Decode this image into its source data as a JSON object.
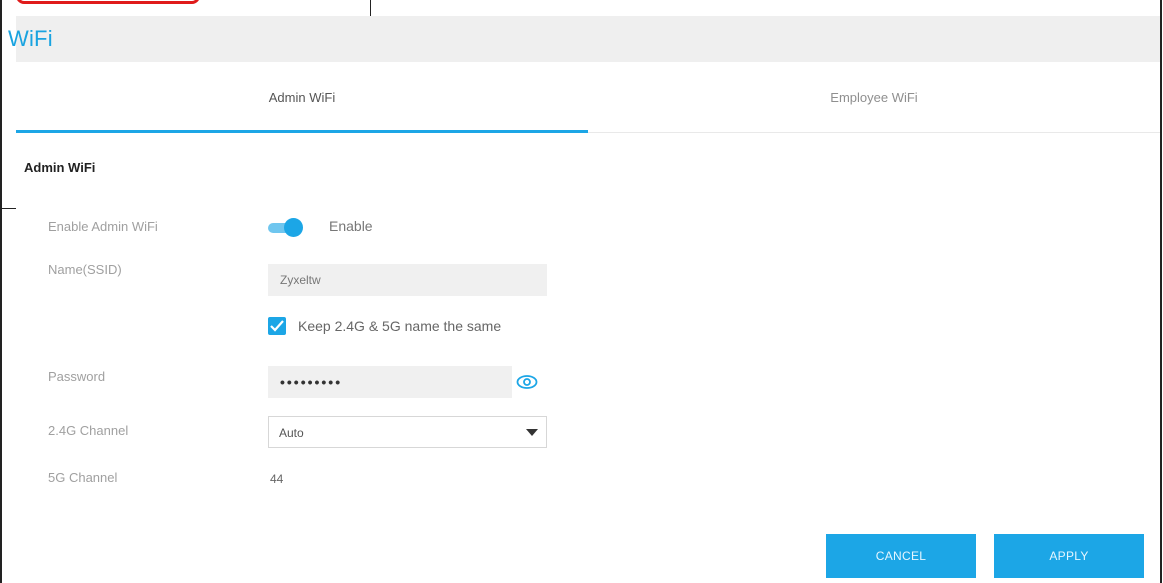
{
  "panel": {
    "title": "WiFi"
  },
  "tabs": [
    {
      "label": "Admin WiFi",
      "active": true
    },
    {
      "label": "Employee WiFi",
      "active": false
    }
  ],
  "form": {
    "section_title": "Admin WiFi",
    "enable": {
      "label": "Enable Admin WiFi",
      "toggle_on": true,
      "state_text": "Enable"
    },
    "ssid": {
      "label": "Name(SSID)",
      "value": "Zyxeltw"
    },
    "keep_same": {
      "checked": true,
      "label": "Keep 2.4G & 5G name the same"
    },
    "password": {
      "label": "Password",
      "value": "•••••••••"
    },
    "channel_24": {
      "label": "2.4G Channel",
      "value": "Auto"
    },
    "channel_5": {
      "label": "5G Channel",
      "value": "44"
    }
  },
  "buttons": {
    "cancel": "CANCEL",
    "apply": "APPLY"
  },
  "colors": {
    "accent": "#1ca6e6",
    "title": "#19a3e0",
    "callout": "#e01b1b"
  },
  "icons": {
    "password_reveal": "eye-icon",
    "select_arrow": "chevron-down-icon",
    "checkbox_mark": "checkmark-icon"
  }
}
